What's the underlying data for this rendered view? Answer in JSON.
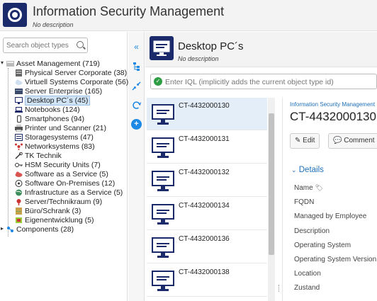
{
  "app": {
    "title": "Information Security Management",
    "description": "No description"
  },
  "tree_search": {
    "placeholder": "Search object types"
  },
  "tree": [
    {
      "label": "Asset Management (719)"
    },
    {
      "label": "Physical Server Corporate (38)"
    },
    {
      "label": "Virtuell Systems Corporate (56)"
    },
    {
      "label": "Server Enterprise (165)"
    },
    {
      "label": "Desktop PC´s (45)"
    },
    {
      "label": "Notebooks (124)"
    },
    {
      "label": "Smartphones (94)"
    },
    {
      "label": "Printer und Scanner (21)"
    },
    {
      "label": "Storagesystems (47)"
    },
    {
      "label": "Networksystems (83)"
    },
    {
      "label": "TK Technik"
    },
    {
      "label": "HSM Security Units (7)"
    },
    {
      "label": "Software as a Service (5)"
    },
    {
      "label": "Software On-Premises (12)"
    },
    {
      "label": "Infrastructure as a Service (5)"
    },
    {
      "label": "Server/Technikraum (9)"
    },
    {
      "label": "Büro/Schrank (3)"
    },
    {
      "label": "Eigenentwicklung (5)"
    },
    {
      "label": "Components (28)"
    }
  ],
  "object_type": {
    "title": "Desktop PC´s",
    "description": "No description"
  },
  "iql": {
    "placeholder": "Enter IQL (implicitly adds the current object type id)"
  },
  "objects": [
    {
      "label": "CT-4432000130"
    },
    {
      "label": "CT-4432000131"
    },
    {
      "label": "CT-4432000132"
    },
    {
      "label": "CT-4432000134"
    },
    {
      "label": "CT-4432000136"
    },
    {
      "label": "CT-4432000138"
    }
  ],
  "detail": {
    "breadcrumb": "Information Security Management",
    "title": "CT-4432000130",
    "edit_label": "Edit",
    "comment_label": "Comment",
    "section_label": "Details",
    "attributes": [
      {
        "label": "Name"
      },
      {
        "label": "FQDN"
      },
      {
        "label": "Managed by Employee"
      },
      {
        "label": "Description"
      },
      {
        "label": "Operating System"
      },
      {
        "label": "Operating System Version"
      },
      {
        "label": "Location"
      },
      {
        "label": "Zustand"
      }
    ]
  },
  "colors": {
    "brand": "#1b2a6b",
    "accent": "#1e88e5",
    "link": "#1e6fb8",
    "selection": "#cfe3f5"
  }
}
